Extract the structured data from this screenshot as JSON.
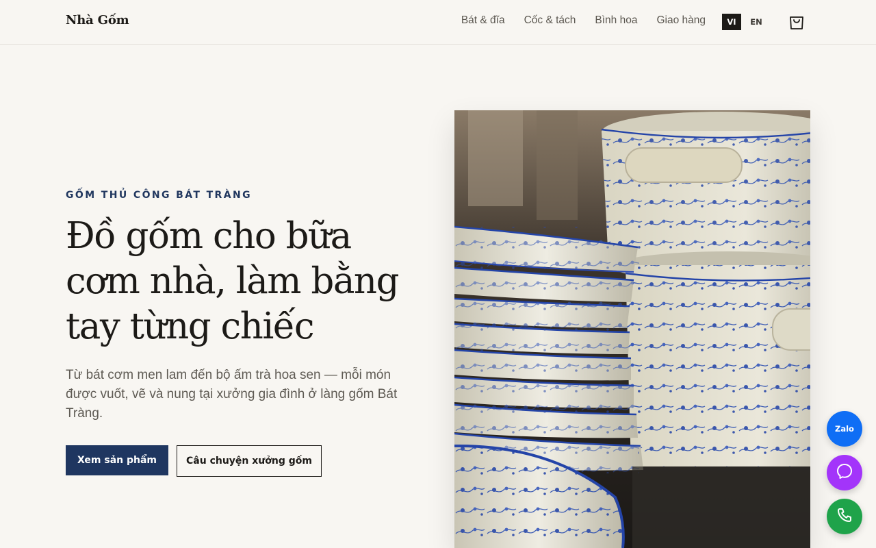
{
  "header": {
    "brand": "Nhà Gốm",
    "nav": [
      "Bát & đĩa",
      "Cốc & tách",
      "Bình hoa",
      "Giao hàng"
    ],
    "languages": {
      "active": "VI",
      "other": "EN"
    },
    "cart_icon": "shopping-bag-icon"
  },
  "hero": {
    "eyebrow": "GỐM THỦ CÔNG BÁT TRÀNG",
    "headline_lines": [
      "Đồ gốm cho bữa",
      "cơm nhà, làm bằng",
      "tay từng chiếc"
    ],
    "lead": "Từ bát cơm men lam đến bộ ấm trà hoa sen — mỗi món được vuốt, vẽ và nung tại xưởng gia đình ở làng gốm Bát Tràng.",
    "primary_button": "Xem sản phẩm",
    "secondary_button": "Câu chuyện xưởng gốm",
    "image_subject": "stacked blue-and-white porcelain bowls"
  },
  "floating_contacts": {
    "zalo_label": "Zalo",
    "messenger_icon": "messenger-icon",
    "phone_icon": "phone-icon"
  },
  "colors": {
    "background": "#f8f6f2",
    "accent_navy": "#1f3660",
    "zalo": "#0f6ef5",
    "messenger": "#a334fa",
    "phone": "#1fa34a"
  }
}
